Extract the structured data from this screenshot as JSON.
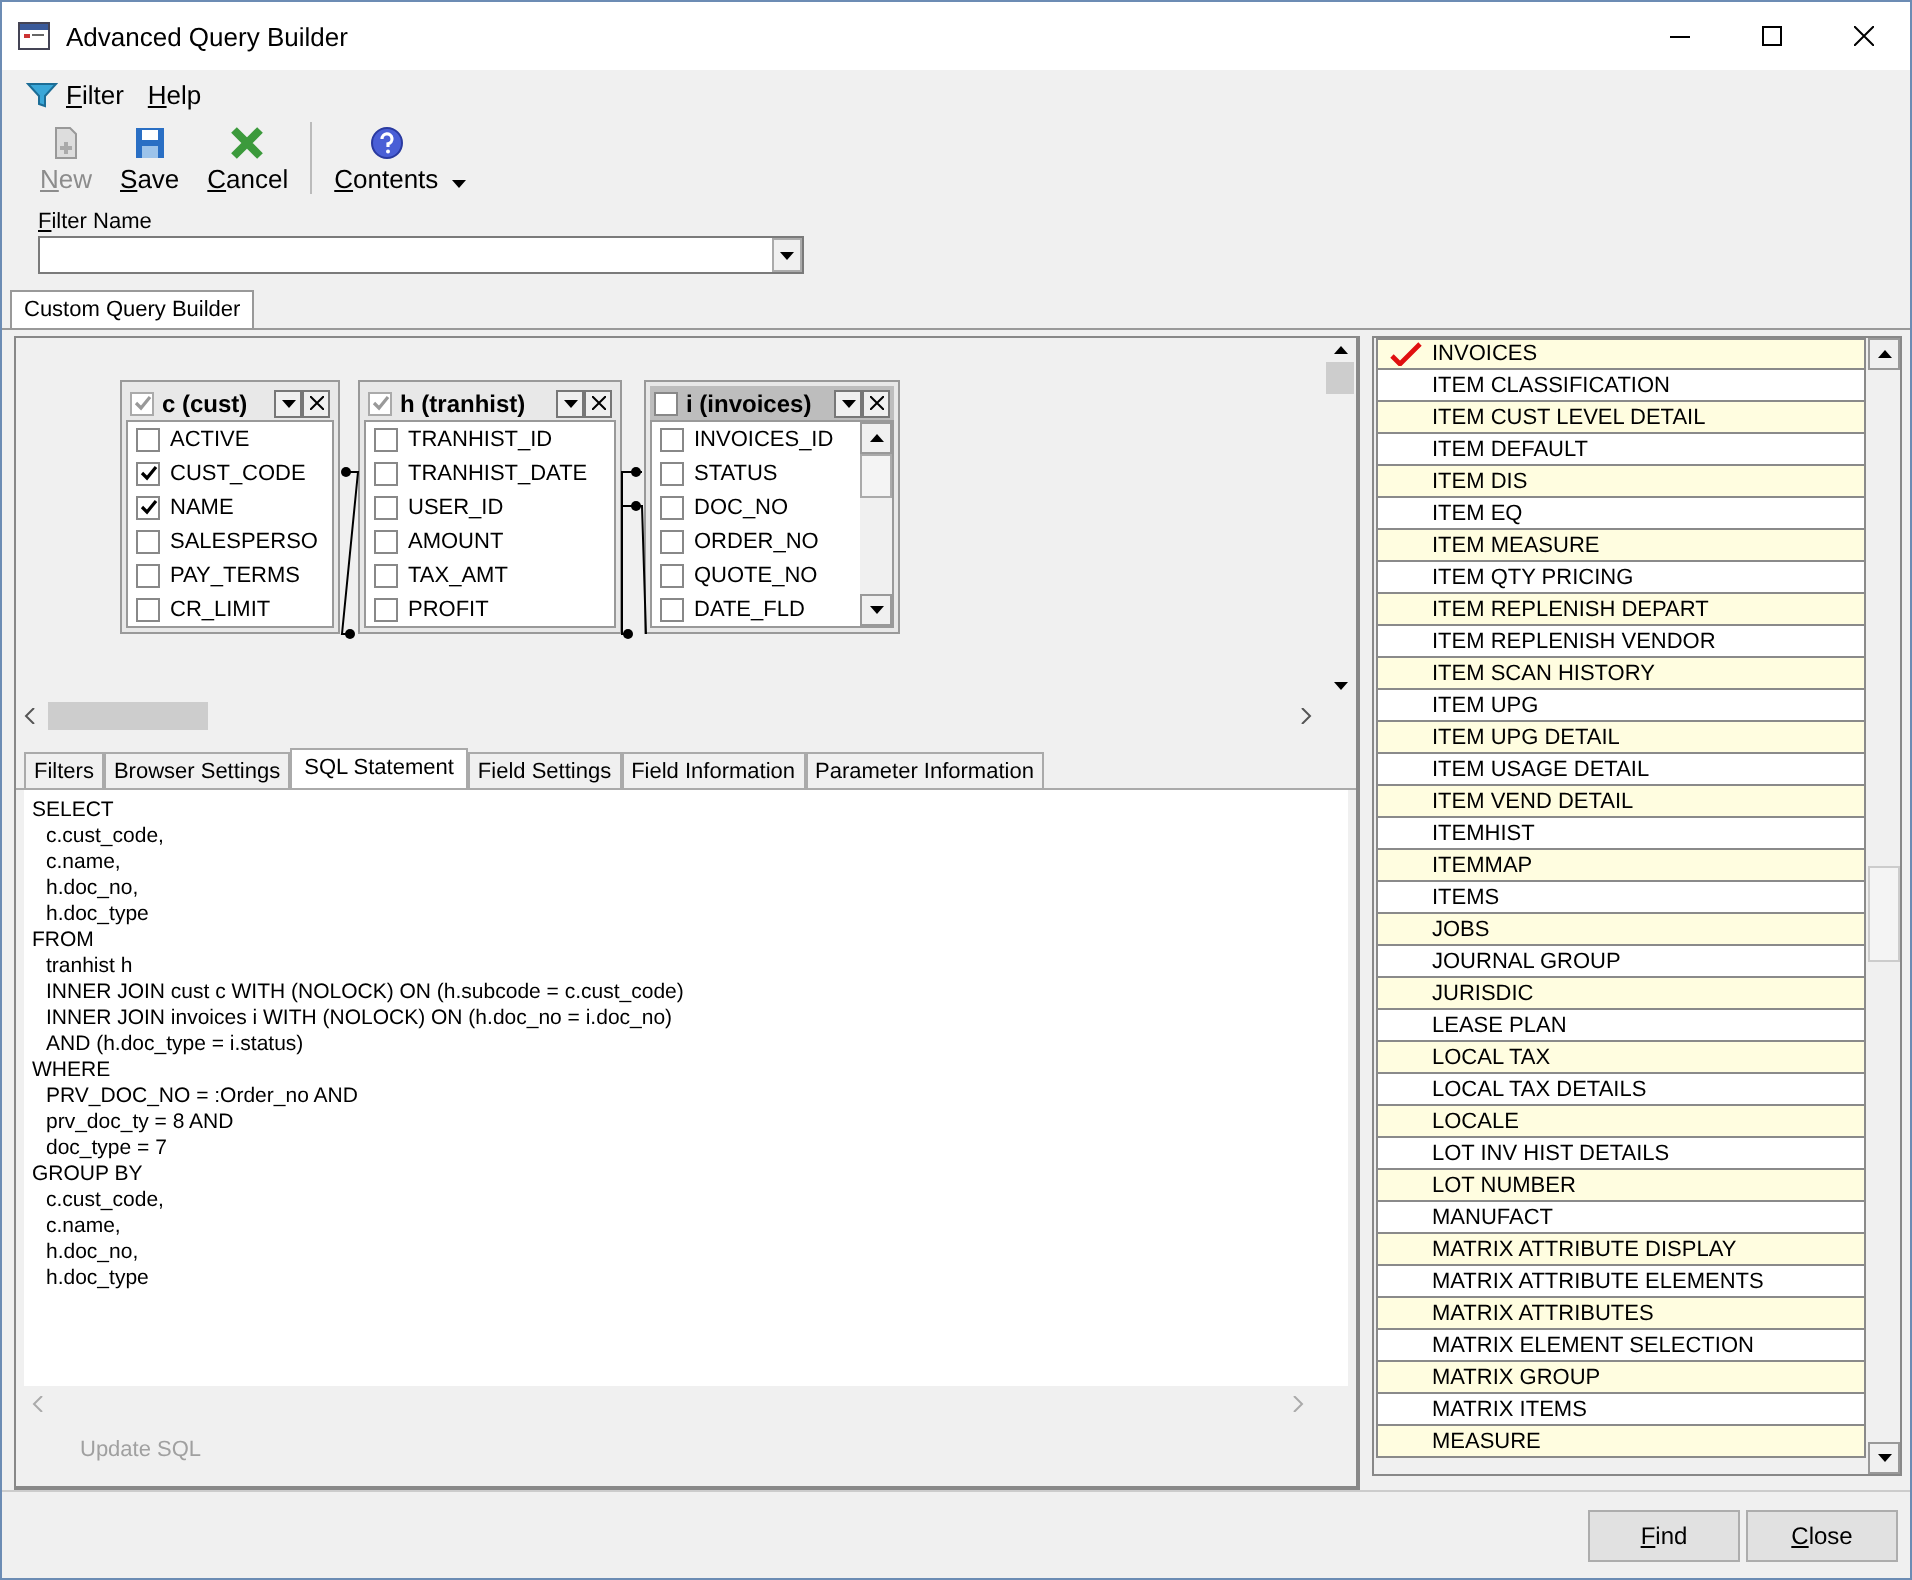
{
  "window": {
    "title": "Advanced Query Builder"
  },
  "menu": [
    {
      "label": "Filter",
      "kind": "filter"
    },
    {
      "label": "Help",
      "kind": "plain"
    }
  ],
  "toolbar": [
    {
      "label": "New",
      "kind": "new",
      "disabled": true
    },
    {
      "label": "Save",
      "kind": "save",
      "disabled": false
    },
    {
      "label": "Cancel",
      "kind": "cancel",
      "disabled": false
    },
    {
      "label": "Contents",
      "kind": "help",
      "disabled": false
    }
  ],
  "filter_name": {
    "label": "Filter Name"
  },
  "top_tabs": [
    {
      "label": "Custom Query Builder",
      "selected": true
    }
  ],
  "tables": [
    {
      "title": "c (cust)",
      "checked": true,
      "selected": false,
      "scrollable": false,
      "fields": [
        {
          "name": "ACTIVE",
          "checked": false
        },
        {
          "name": "CUST_CODE",
          "checked": true
        },
        {
          "name": "NAME",
          "checked": true
        },
        {
          "name": "SALESPERSO",
          "checked": false
        },
        {
          "name": "PAY_TERMS",
          "checked": false
        },
        {
          "name": "CR_LIMIT",
          "checked": false
        }
      ]
    },
    {
      "title": "h (tranhist)",
      "checked": true,
      "selected": false,
      "scrollable": false,
      "fields": [
        {
          "name": "TRANHIST_ID",
          "checked": false
        },
        {
          "name": "TRANHIST_DATE",
          "checked": false
        },
        {
          "name": "USER_ID",
          "checked": false
        },
        {
          "name": "AMOUNT",
          "checked": false
        },
        {
          "name": "TAX_AMT",
          "checked": false
        },
        {
          "name": "PROFIT",
          "checked": false
        }
      ]
    },
    {
      "title": "i (invoices)",
      "checked": false,
      "selected": true,
      "scrollable": true,
      "fields": [
        {
          "name": "INVOICES_ID",
          "checked": false
        },
        {
          "name": "STATUS",
          "checked": false
        },
        {
          "name": "DOC_NO",
          "checked": false
        },
        {
          "name": "ORDER_NO",
          "checked": false
        },
        {
          "name": "QUOTE_NO",
          "checked": false
        },
        {
          "name": "DATE_FLD",
          "checked": false
        }
      ]
    }
  ],
  "bottom_tabs": [
    {
      "label": "Filters",
      "selected": false
    },
    {
      "label": "Browser Settings",
      "selected": false
    },
    {
      "label": "SQL Statement",
      "selected": true
    },
    {
      "label": "Field Settings",
      "selected": false
    },
    {
      "label": "Field Information",
      "selected": false
    },
    {
      "label": "Parameter Information",
      "selected": false
    }
  ],
  "sql": [
    {
      "text": "SELECT",
      "kind": "clause"
    },
    {
      "text": "c.cust_code,",
      "kind": "item"
    },
    {
      "text": "c.name,",
      "kind": "item"
    },
    {
      "text": "h.doc_no,",
      "kind": "item"
    },
    {
      "text": "h.doc_type",
      "kind": "item"
    },
    {
      "text": "FROM",
      "kind": "clause"
    },
    {
      "text": "tranhist h",
      "kind": "item"
    },
    {
      "text": "INNER JOIN cust c WITH (NOLOCK) ON (h.subcode = c.cust_code)",
      "kind": "item"
    },
    {
      "text": "INNER JOIN invoices i WITH (NOLOCK) ON (h.doc_no = i.doc_no)",
      "kind": "item"
    },
    {
      "text": "AND (h.doc_type = i.status)",
      "kind": "item"
    },
    {
      "text": "WHERE",
      "kind": "clause"
    },
    {
      "text": "PRV_DOC_NO = :Order_no AND",
      "kind": "item"
    },
    {
      "text": "prv_doc_ty = 8 AND",
      "kind": "item"
    },
    {
      "text": "doc_type = 7",
      "kind": "item"
    },
    {
      "text": "GROUP BY",
      "kind": "clause"
    },
    {
      "text": "c.cust_code,",
      "kind": "item"
    },
    {
      "text": "c.name,",
      "kind": "item"
    },
    {
      "text": "h.doc_no,",
      "kind": "item"
    },
    {
      "text": "h.doc_type",
      "kind": "item"
    }
  ],
  "update_sql": {
    "label": "Update SQL",
    "disabled": true
  },
  "table_list": [
    {
      "name": "INVOICES",
      "checked": true
    },
    {
      "name": "ITEM CLASSIFICATION",
      "checked": false
    },
    {
      "name": "ITEM CUST LEVEL DETAIL",
      "checked": false
    },
    {
      "name": "ITEM DEFAULT",
      "checked": false
    },
    {
      "name": "ITEM DIS",
      "checked": false
    },
    {
      "name": "ITEM EQ",
      "checked": false
    },
    {
      "name": "ITEM MEASURE",
      "checked": false
    },
    {
      "name": "ITEM QTY PRICING",
      "checked": false
    },
    {
      "name": "ITEM REPLENISH DEPART",
      "checked": false
    },
    {
      "name": "ITEM REPLENISH VENDOR",
      "checked": false
    },
    {
      "name": "ITEM SCAN HISTORY",
      "checked": false
    },
    {
      "name": "ITEM UPG",
      "checked": false
    },
    {
      "name": "ITEM UPG DETAIL",
      "checked": false
    },
    {
      "name": "ITEM USAGE DETAIL",
      "checked": false
    },
    {
      "name": "ITEM VEND DETAIL",
      "checked": false
    },
    {
      "name": "ITEMHIST",
      "checked": false
    },
    {
      "name": "ITEMMAP",
      "checked": false
    },
    {
      "name": "ITEMS",
      "checked": false
    },
    {
      "name": "JOBS",
      "checked": false
    },
    {
      "name": "JOURNAL GROUP",
      "checked": false
    },
    {
      "name": "JURISDIC",
      "checked": false
    },
    {
      "name": "LEASE PLAN",
      "checked": false
    },
    {
      "name": "LOCAL TAX",
      "checked": false
    },
    {
      "name": "LOCAL TAX DETAILS",
      "checked": false
    },
    {
      "name": "LOCALE",
      "checked": false
    },
    {
      "name": "LOT INV HIST DETAILS",
      "checked": false
    },
    {
      "name": "LOT NUMBER",
      "checked": false
    },
    {
      "name": "MANUFACT",
      "checked": false
    },
    {
      "name": "MATRIX ATTRIBUTE DISPLAY",
      "checked": false
    },
    {
      "name": "MATRIX ATTRIBUTE ELEMENTS",
      "checked": false
    },
    {
      "name": "MATRIX ATTRIBUTES",
      "checked": false
    },
    {
      "name": "MATRIX ELEMENT SELECTION",
      "checked": false
    },
    {
      "name": "MATRIX GROUP",
      "checked": false
    },
    {
      "name": "MATRIX ITEMS",
      "checked": false
    },
    {
      "name": "MEASURE",
      "checked": false
    }
  ],
  "buttons": [
    {
      "label": "Find"
    },
    {
      "label": "Close"
    }
  ]
}
